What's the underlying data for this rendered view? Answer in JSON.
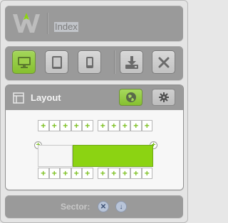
{
  "header": {
    "title": "Index",
    "accent": "#8cd312"
  },
  "toolbar": {
    "buttons": [
      {
        "name": "desktop-view",
        "icon": "desktop-icon",
        "active": true
      },
      {
        "name": "tablet-view",
        "icon": "tablet-icon",
        "active": false
      },
      {
        "name": "mobile-view",
        "icon": "mobile-icon",
        "active": false
      },
      {
        "name": "download",
        "icon": "download-icon",
        "active": false
      },
      {
        "name": "close",
        "icon": "close-icon",
        "active": false
      }
    ]
  },
  "layout_panel": {
    "title": "Layout",
    "buttons": [
      {
        "name": "globe",
        "icon": "globe-icon",
        "active": true
      },
      {
        "name": "settings",
        "icon": "gear-icon",
        "active": false
      }
    ],
    "plus_symbol": "+"
  },
  "footer": {
    "label": "Sector:",
    "actions": [
      {
        "name": "remove",
        "icon": "close-icon",
        "glyph": "✕"
      },
      {
        "name": "move-down",
        "icon": "arrow-down-icon",
        "glyph": "↓"
      }
    ]
  }
}
